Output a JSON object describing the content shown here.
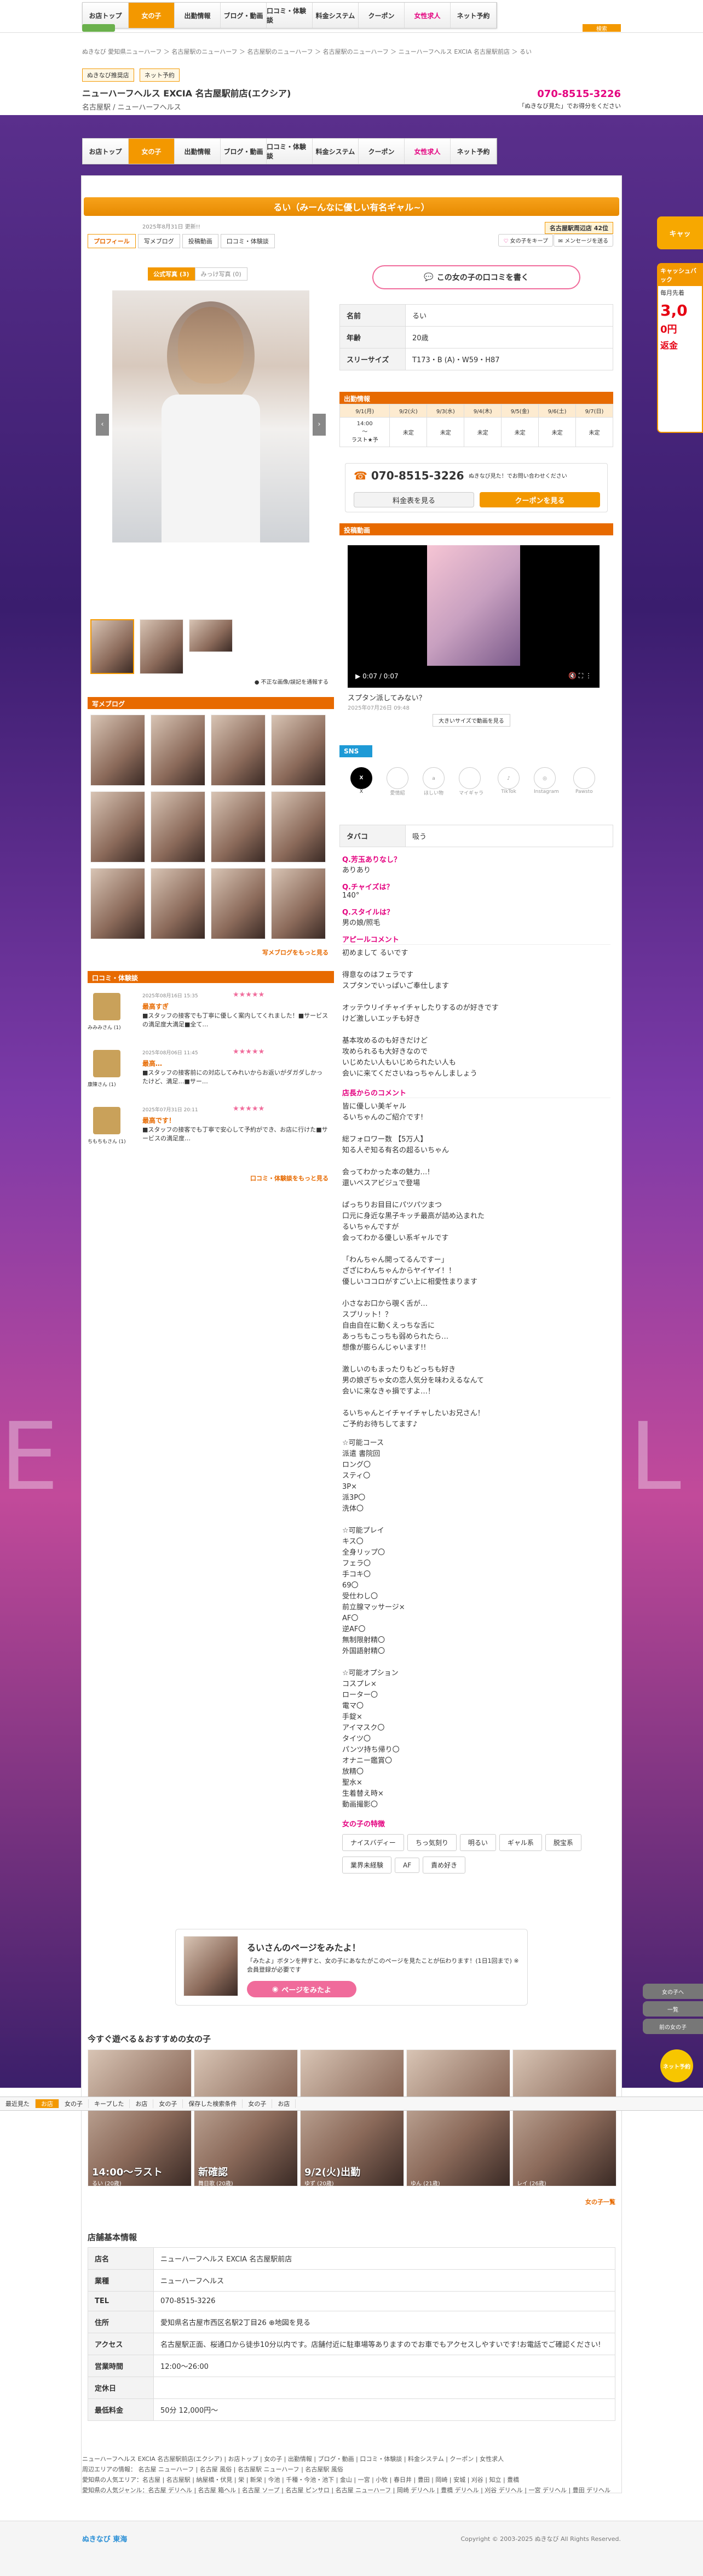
{
  "nav": {
    "items": [
      "お店トップ",
      "女の子",
      "出勤情報",
      "ブログ・動画",
      "口コミ・体験談",
      "料金システム",
      "クーポン",
      "女性求人",
      "ネット予約"
    ],
    "active": 1
  },
  "header": {
    "search_label": "検索"
  },
  "breadcrumb": "ぬきなび 愛知県ニューハーフ ＞ 名古屋駅のニューハーフ ＞ 名古屋駅のニューハーフ ＞ 名古屋駅のニューハーフ ＞ ニューハーフヘルス EXCIA 名古屋駅前店 ＞ るい",
  "shop": {
    "badge1": "ぬきなび推奨店",
    "badge2": "ネット予約",
    "name": "ニューハーフヘルス EXCIA 名古屋駅前店(エクシア)",
    "sub": "名古屋駅 / ニューハーフヘルス",
    "tel": "070-8515-3226",
    "tel_note": "「ぬきなび見た」でお得分をください"
  },
  "girl": {
    "title": "るい（みーんなに優しい有名ギャル~）",
    "updated": "2025年8月31日 更新!!",
    "rank": "名古屋駅周辺店 42位",
    "tabs": [
      "プロフィール",
      "写メブログ",
      "投稿動画",
      "口コミ・体験談"
    ],
    "fav_label": "女の子をキープ",
    "share_label": "メンセージを送る",
    "photo_tabs": [
      "公式写真 (3)",
      "みっけ写真 (0)"
    ],
    "report_label": "不正な画像/誤記を通報する",
    "review_btn": "この女の子の口コミを書く",
    "profile": [
      {
        "k": "名前",
        "v": "るい"
      },
      {
        "k": "年齢",
        "v": "20歳"
      },
      {
        "k": "スリーサイズ",
        "v": "T173・B (A)・W59・H87"
      }
    ],
    "schedule_title": "出勤情報",
    "schedule_days": [
      "9/1(月)",
      "9/2(火)",
      "9/3(水)",
      "9/4(木)",
      "9/5(金)",
      "9/6(土)",
      "9/7(日)"
    ],
    "schedule_vals": [
      "14:00\n〜\nラスト★予",
      "未定",
      "未定",
      "未定",
      "未定",
      "未定",
      "未定"
    ],
    "contact_tel": "070-8515-3226",
    "contact_note": "ぬきなび見た！でお問い合わせください",
    "price_btn": "料金表を見る",
    "coupon_btn": "クーポンを見る",
    "video_title": "投稿動画",
    "video_time": "0:07 / 0:07",
    "video_caption": "スプタン派してみない？",
    "video_date": "2025年07月26日 09:48",
    "video_big": "大きいサイズで動画を見る",
    "sns_title": "SNS",
    "sns": [
      "X",
      "愛情紹",
      "ほしい物",
      "マイギャラ",
      "TikTok",
      "Instagram",
      "Pawsto"
    ],
    "tobacco_k": "タバコ",
    "tobacco_v": "吸う",
    "qa": [
      {
        "q": "Q.芳玉ありなし？",
        "a": "ありあり"
      },
      {
        "q": "Q.チャイズは？",
        "a": "140°"
      },
      {
        "q": "Q.スタイルは？",
        "a": "男の娘/照毛"
      }
    ],
    "appeal_title": "アピールコメント",
    "appeal": "初めまして るいです\n\n得意なのはフェラです\nスプタンでいっぱいご奉仕します\n\nオッテウリイチャイチャしたりするのが好きです\nけど激しいエッチも好き\n\n基本攻めるのも好きだけど\n攻められるも大好きなので\nいじめたい人もいじめられたい人も\n会いに来てくださいねっちゃんしましょう",
    "staff_title": "店長からのコメント",
    "staff": "皆に優しい美ギャル\nるいちゃんのご紹介です!\n\n総フォロワー数 【5万人】\n知る人ぞ知る有名の超るいちゃん\n\n会ってわかった本の魅力…!\n還いペスアビジュで登場\n\nぱっちりお目目にパツパツまつ\n口元に身近な黒子キッチ最高が詰め込まれた\nるいちゃんですが\n会ってわかる優しい系ギャルです\n\n「わんちゃん開ってるんですー」\nざざにわんちゃんからヤイヤイ！！\n優しいココロがすごい上に相愛性まります\n\n小さなお口から覗く舌が…\nスプリット！？\n自由自在に動くえっちな舌に\nあっちもこっちも弱められたら…\n想像が膨らんじゃいます!!\n\n激しいのもまったりもどっちも好き\n男の娘ぎちゃ女の恋人気分を味わえるなんて\n会いに来なきゃ損ですよ…！\n\nるいちゃんとイチャイチャしたいお兄さん！\nご予約お待ちしてます♪",
    "options": "☆可能コース\n派遣 書院回\nロング〇\nスティ〇\n3P×\n派3P〇\n洗体〇\n\n☆可能プレイ\nキス〇\n全身リップ〇\nフェラ〇\n手コキ〇\n69〇\n受仕わし〇\n前立腺マッサージ×\nAF〇\n逆AF〇\n無制限射精〇\n外国語射精〇\n\n☆可能オプション\nコスプレ×\nローター〇\n電マ〇\n手錠×\nアイマスク〇\nタイツ〇\nパンツ持ち帰り〇\nオナニー鑑賞〇\n放精〇\n聖水×\n生着替え時×\n動画撮影〇",
    "traits_title": "女の子の特徴",
    "traits": [
      "ナイスバディー",
      "ちっ気刻り",
      "明るい",
      "ギャル系",
      "脱宝系",
      "業界未経験",
      "AF",
      "責め好き"
    ]
  },
  "blog": {
    "title": "写メブログ",
    "more": "写メブログをもっと見る"
  },
  "reviews": {
    "title": "口コミ・体験談",
    "items": [
      {
        "user": "みみみさん (1)",
        "date": "2025年08月16日 15:35",
        "title": "最高すぎ",
        "body": "■スタッフの接客でも丁寧に優しく案内してくれました！■サービスの満足度大満足■全て…"
      },
      {
        "user": "康陳さん (1)",
        "date": "2025年08月06日 11:45",
        "title": "最高…",
        "body": "■スタッフの接客前にの対応してみれいからお返いがダガダしかったけど、満足…■サー…"
      },
      {
        "user": "ちもちもさん (1)",
        "date": "2025年07月31日 20:11",
        "title": "最高です！",
        "body": "■スタッフの接客でも丁寧で安心して予約ができ、お店に行けた■サービスの満足度…"
      }
    ],
    "more": "口コミ・体験談をもっと見る"
  },
  "promo": {
    "title": "るいさんのページをみたよ！",
    "body": "「みたよ」ボタンを押すと、女の子にあなたがこのページを見たことが伝わります！(1日1回まで) ※会員登録が必要です",
    "btn": "ページをみたよ"
  },
  "recommend": {
    "title": "今すぐ遊べる＆おすすめの女の子",
    "items": [
      {
        "label": "14:00〜ラスト",
        "name": "るい (20歳)"
      },
      {
        "label": "新確認",
        "name": "舞日歌 (20歳)"
      },
      {
        "label": "9/2(火)出勤",
        "name": "ゆず (20歳)"
      },
      {
        "label": "",
        "name": "ゆん (21歳)"
      },
      {
        "label": "",
        "name": "レイ (26歳)"
      }
    ],
    "more": "女の子一覧"
  },
  "shopinfo": {
    "title": "店舗基本情報",
    "rows": [
      {
        "k": "店名",
        "v": "ニューハーフヘルス EXCIA 名古屋駅前店"
      },
      {
        "k": "業種",
        "v": "ニューハーフヘルス"
      },
      {
        "k": "TEL",
        "v": "070-8515-3226"
      },
      {
        "k": "住所",
        "v": "愛知県名古屋市西区名駅2丁目26 ⊕地図を見る"
      },
      {
        "k": "アクセス",
        "v": "名古屋駅正面、桜通口から徒歩10分以内です。店舗付近に駐車場等ありますのでお車でもアクセスしやすいです!お電話でご確認ください!"
      },
      {
        "k": "営業時間",
        "v": "12:00〜26:00"
      },
      {
        "k": "定休日",
        "v": ""
      },
      {
        "k": "最低料金",
        "v": "50分 12,000円〜"
      }
    ]
  },
  "bottombar": [
    "最近見た",
    "お店",
    "女の子",
    "キープした",
    "お店",
    "女の子",
    "保存した検索条件",
    "女の子",
    "お店"
  ],
  "footer": {
    "line1": "ニューハーフヘルス EXCIA 名古屋駅前店(エクシア) | お店トップ | 女の子 | 出勤情報 | ブログ・動画 | 口コミ・体験談 | 料金システム | クーポン | 女性求人",
    "line2": "周辺エリアの情報： 名古屋 ニューハーフ | 名古屋 風俗 | 名古屋駅 ニューハーフ | 名古屋駅 風俗",
    "line3": "愛知県の人気エリア：名古屋 | 名古屋駅 | 納屋橋・伏見 | 栄 | 新栄 | 今池 | 千種・今池・池下 | 金山 | 一宮 | 小牧 | 春日井 | 豊田 | 岡崎 | 安城 | 刈谷 | 知立 | 豊橋",
    "line4": "愛知県の人気ジャンル：名古屋 デリヘル | 名古屋 箱ヘル | 名古屋 ソープ | 名古屋 ピンサロ | 名古屋 ニューハーフ | 岡崎 デリヘル | 豊橋 デリヘル | 刈谷 デリヘル | 一宮 デリヘル | 豊田 デリヘル",
    "copyright": "Copyright © 2003-2025 ぬきなび All Rights Reserved.",
    "brand": "ぬきなび 東海"
  },
  "side": {
    "cash_label": "キャッシュバック",
    "cash_title": "毎月先着",
    "cash_big": "3,0",
    "cash_unit": "0円",
    "cash_sub": "返金",
    "top_btn": "キャッ",
    "back_label": "女の子へ",
    "list_label": "一覧",
    "prev_label": "前の女の子",
    "reserve": "ネット予約"
  }
}
